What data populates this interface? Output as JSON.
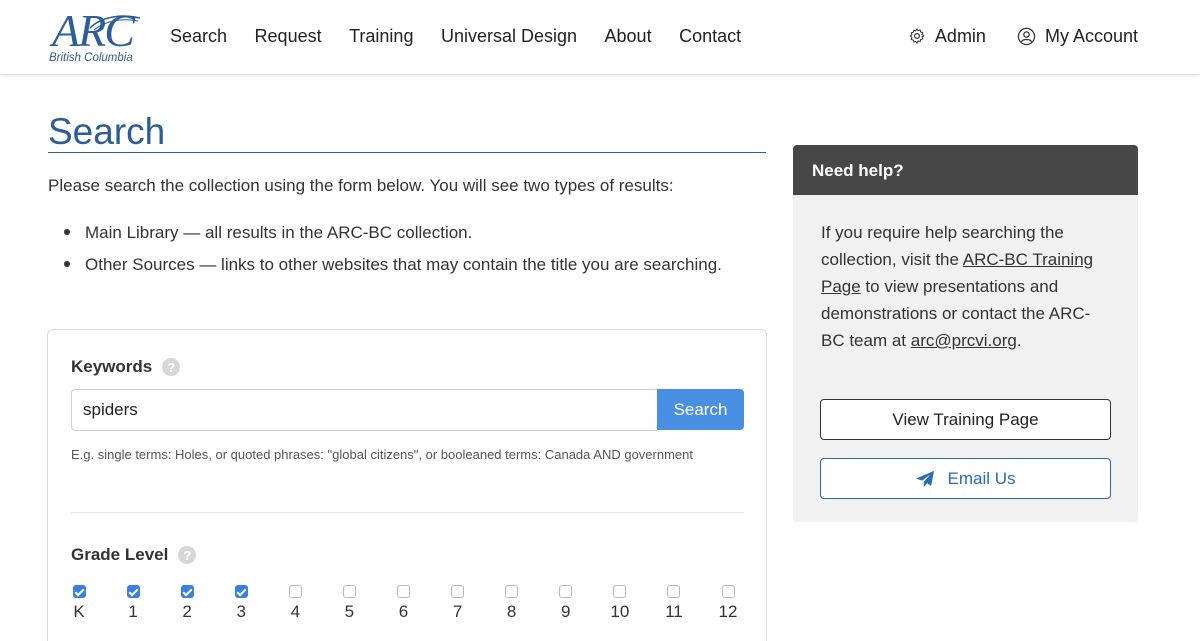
{
  "header": {
    "logo_text": "ARC",
    "logo_subtitle": "British Columbia",
    "nav": [
      {
        "label": "Search"
      },
      {
        "label": "Request"
      },
      {
        "label": "Training"
      },
      {
        "label": "Universal Design"
      },
      {
        "label": "About"
      },
      {
        "label": "Contact"
      }
    ],
    "admin": {
      "label": "Admin",
      "icon": "gear-icon"
    },
    "account": {
      "label": "My Account",
      "icon": "user-circle-icon"
    }
  },
  "main": {
    "title": "Search",
    "intro": "Please search the collection using the form below. You will see two types of results:",
    "bullets": [
      "Main Library — all results in the ARC-BC collection.",
      "Other Sources — links to other websites that may contain the title you are searching."
    ],
    "search_form": {
      "keywords_label": "Keywords",
      "keywords_value": "spiders",
      "search_button": "Search",
      "hint": "E.g. single terms: Holes, or quoted phrases: \"global citizens\", or booleaned terms: Canada AND government",
      "grade_label": "Grade Level",
      "help_glyph": "?",
      "grades": [
        {
          "label": "K",
          "checked": true
        },
        {
          "label": "1",
          "checked": true
        },
        {
          "label": "2",
          "checked": true
        },
        {
          "label": "3",
          "checked": true
        },
        {
          "label": "4",
          "checked": false
        },
        {
          "label": "5",
          "checked": false
        },
        {
          "label": "6",
          "checked": false
        },
        {
          "label": "7",
          "checked": false
        },
        {
          "label": "8",
          "checked": false
        },
        {
          "label": "9",
          "checked": false
        },
        {
          "label": "10",
          "checked": false
        },
        {
          "label": "11",
          "checked": false
        },
        {
          "label": "12",
          "checked": false
        }
      ]
    }
  },
  "sidebar": {
    "heading": "Need help?",
    "text_1": "If you require help searching the collection, visit the ",
    "link_training": "ARC-BC Training Page",
    "text_2": " to view presentations and demonstrations or contact the ARC-BC team at ",
    "link_email": "arc@prcvi.org",
    "text_3": ".",
    "button_training": "View Training Page",
    "button_email": "Email Us",
    "email_icon": "paper-plane-icon"
  },
  "colors": {
    "brand_blue": "#2a5d9a",
    "button_blue": "#4a90e2",
    "checkbox_blue": "#3a80e0",
    "panel_header": "#474747",
    "panel_bg": "#f1f1f1"
  }
}
